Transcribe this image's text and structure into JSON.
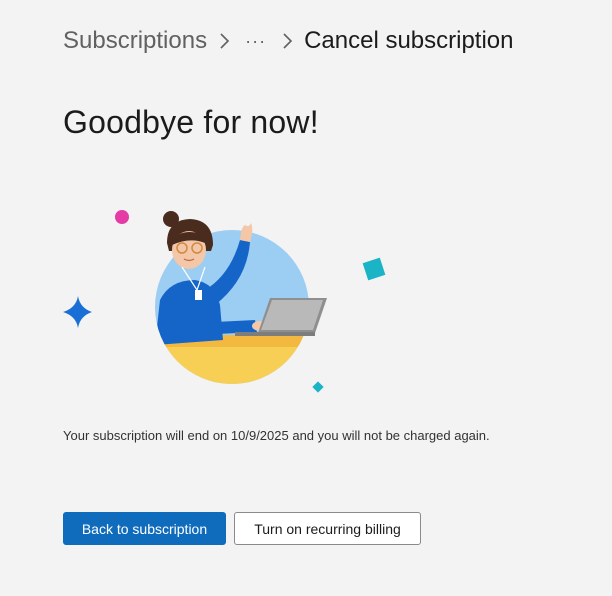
{
  "breadcrumb": {
    "items": [
      {
        "label": "Subscriptions"
      },
      {
        "label": "···"
      },
      {
        "label": "Cancel subscription"
      }
    ]
  },
  "page": {
    "title": "Goodbye for now!",
    "message": "Your subscription will end on 10/9/2025 and you will not be charged again."
  },
  "actions": {
    "primary_label": "Back to subscription",
    "secondary_label": "Turn on recurring billing"
  },
  "colors": {
    "background": "#f3f3f3",
    "accent": "#0f6cbd"
  },
  "icons": {
    "separator": "chevron-right-icon",
    "sparkle": "sparkle-icon"
  }
}
